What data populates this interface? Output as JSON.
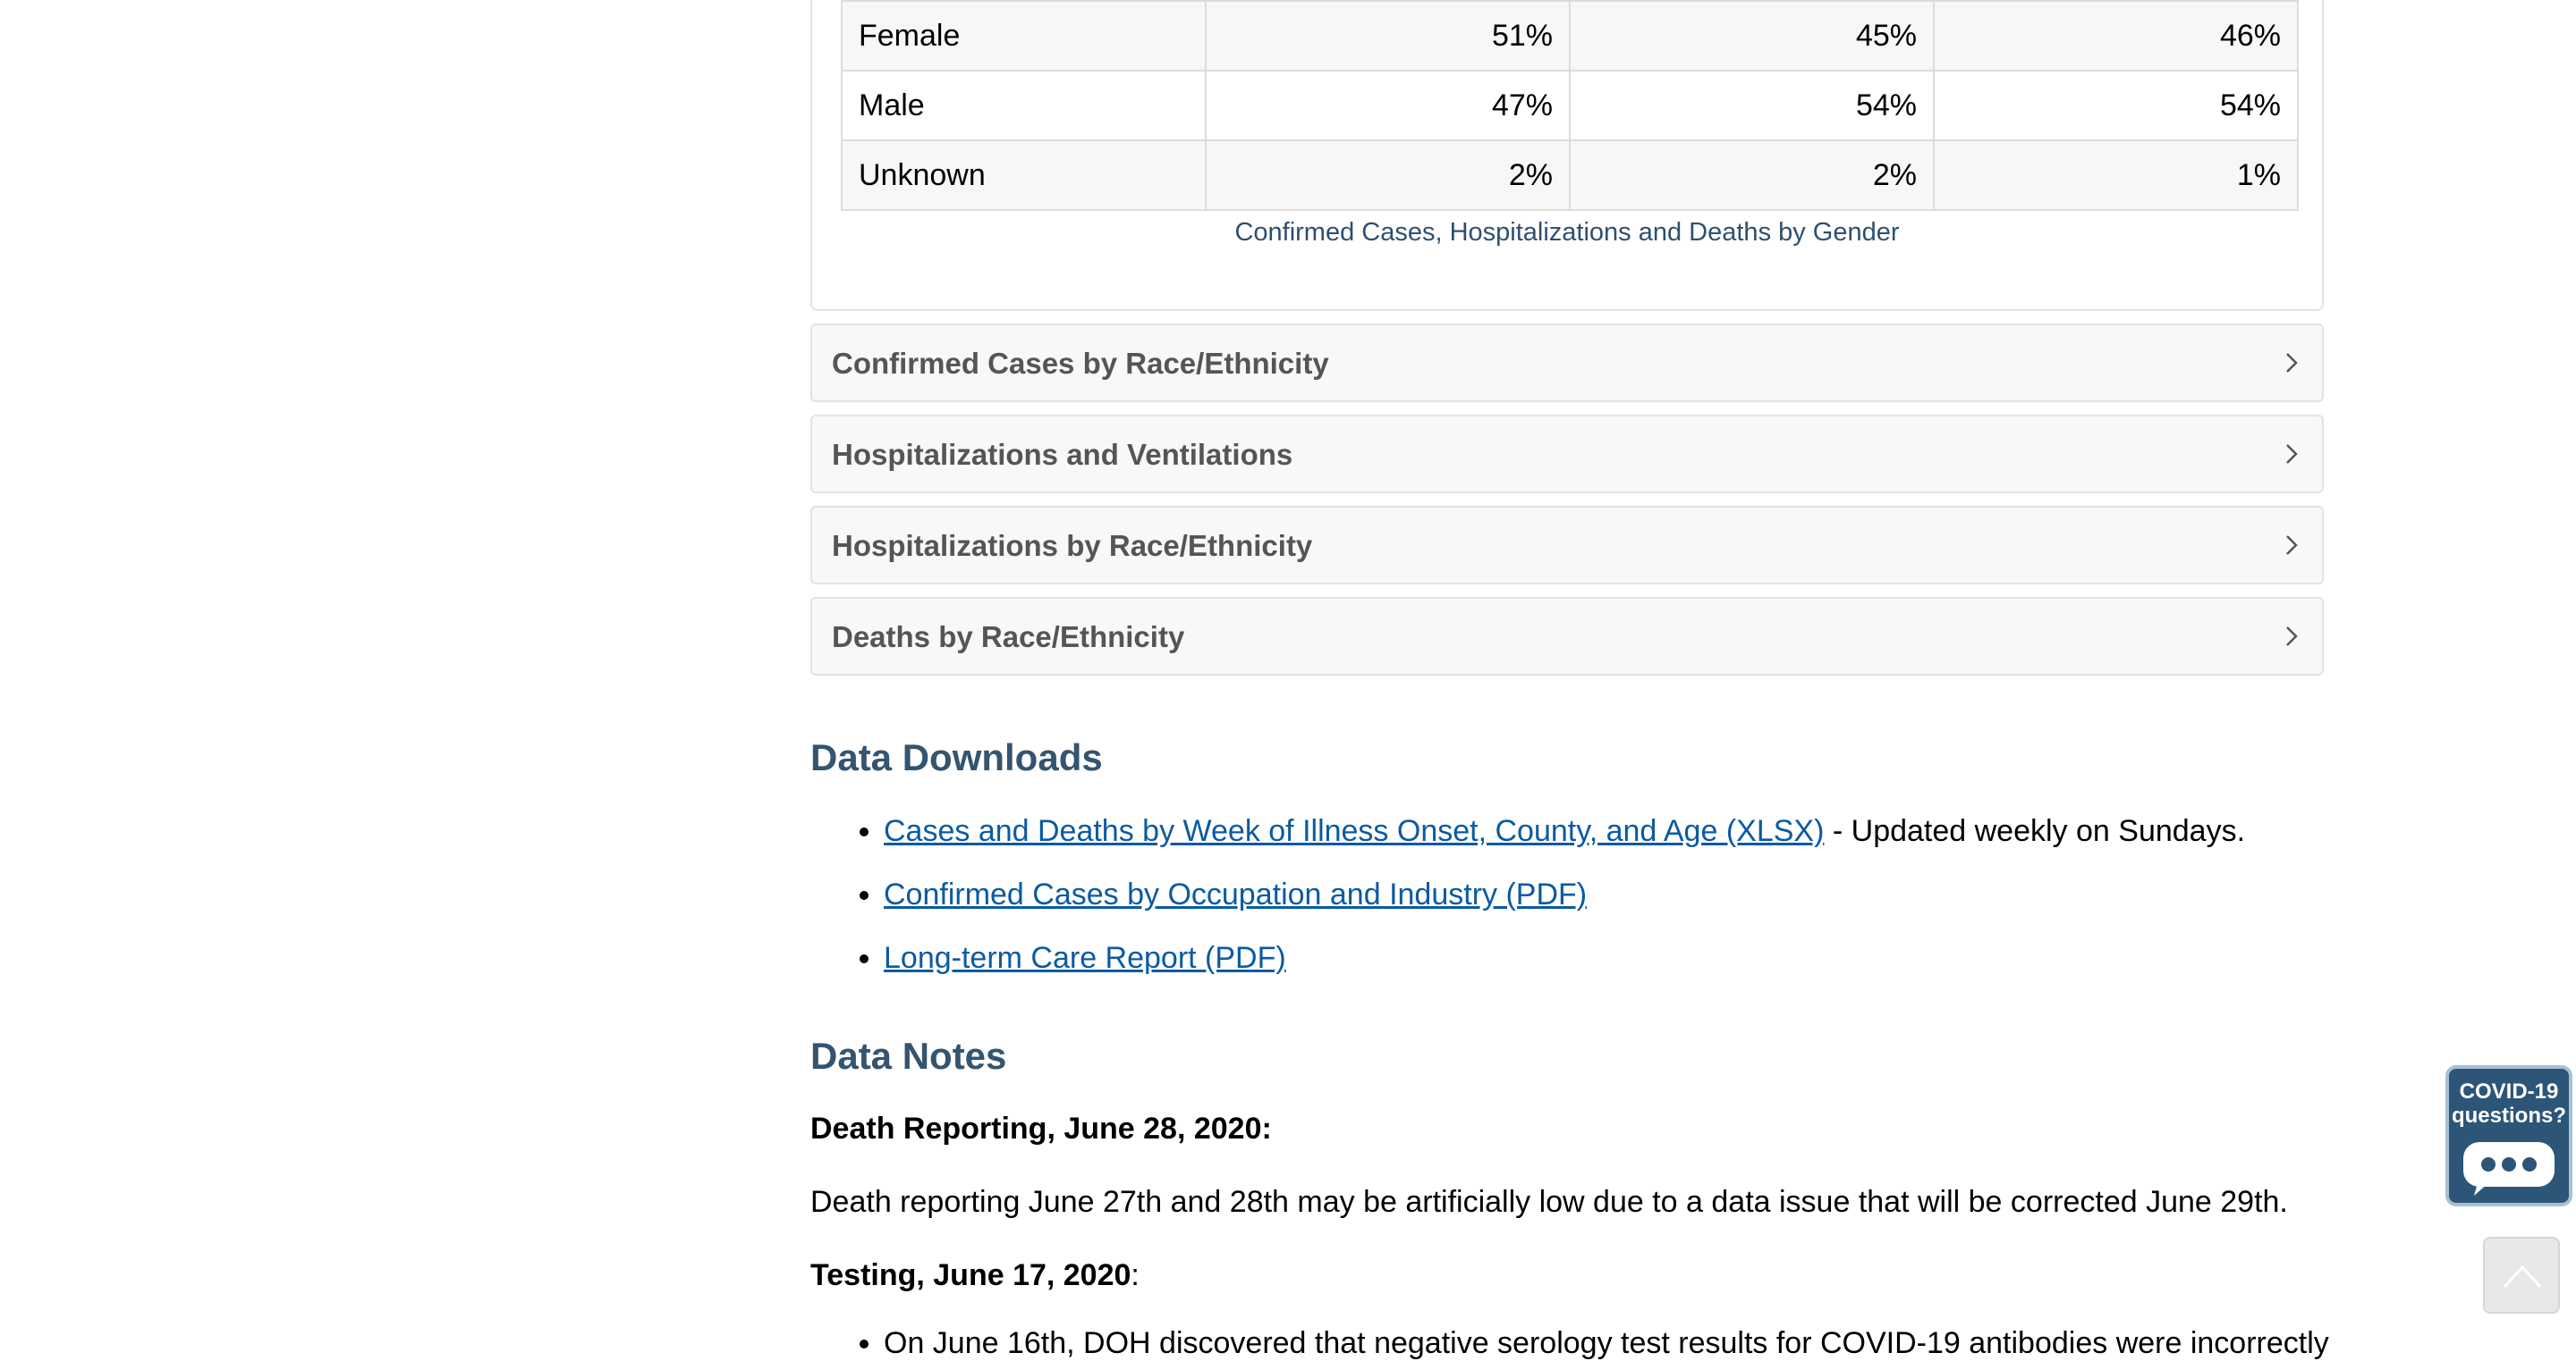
{
  "gender_table": {
    "rows": [
      {
        "label": "Female",
        "values": [
          "51%",
          "45%",
          "46%"
        ]
      },
      {
        "label": "Male",
        "values": [
          "47%",
          "54%",
          "54%"
        ]
      },
      {
        "label": "Unknown",
        "values": [
          "2%",
          "2%",
          "1%"
        ]
      }
    ],
    "caption": "Confirmed Cases, Hospitalizations and Deaths by Gender"
  },
  "accordions": [
    {
      "label": "Confirmed Cases by Race/Ethnicity"
    },
    {
      "label": "Hospitalizations and Ventilations"
    },
    {
      "label": "Hospitalizations by Race/Ethnicity"
    },
    {
      "label": "Deaths by Race/Ethnicity"
    }
  ],
  "downloads": {
    "heading": "Data Downloads",
    "items": [
      {
        "link": "Cases and Deaths by Week of Illness Onset, County, and Age (XLSX)",
        "suffix": " - Updated weekly on Sundays."
      },
      {
        "link": "Confirmed Cases by Occupation and Industry (PDF)",
        "suffix": ""
      },
      {
        "link": "Long-term Care Report (PDF)",
        "suffix": ""
      }
    ]
  },
  "notes": {
    "heading": "Data Notes",
    "death_heading": "Death Reporting, June 28, 2020:",
    "death_text": "Death reporting June 27th and 28th may be artificially low due to a data issue that will be corrected June 29th.",
    "testing_heading": "Testing, June 17, 2020",
    "testing_colon": ":",
    "testing_item": "On June 16th, DOH discovered that negative serology test results for COVID-19 antibodies were incorrectly"
  },
  "widget": {
    "line1": "COVID-19",
    "line2": "questions?",
    "icon": "chat-bubble-icon"
  },
  "scroll_top": {
    "icon": "chevron-up-icon"
  },
  "colors": {
    "heading": "#34546f",
    "link": "#0b5aa2",
    "widget_bg": "#2d5577"
  }
}
